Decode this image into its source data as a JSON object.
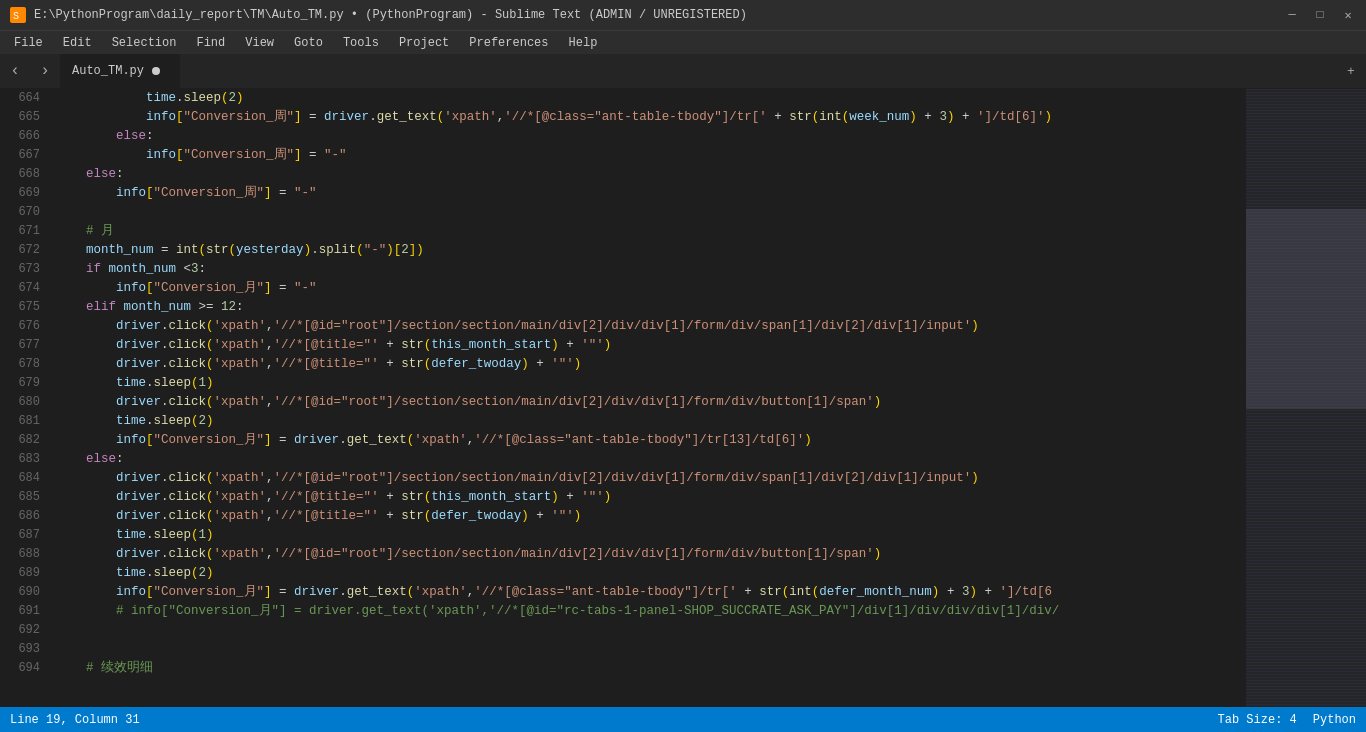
{
  "titlebar": {
    "title": "E:\\PythonProgram\\daily_report\\TM\\Auto_TM.py • (PythonProgram) - Sublime Text (ADMIN / UNREGISTERED)",
    "minimize": "─",
    "maximize": "□",
    "close": "✕"
  },
  "menubar": {
    "items": [
      "File",
      "Edit",
      "Selection",
      "Find",
      "View",
      "Goto",
      "Tools",
      "Project",
      "Preferences",
      "Help"
    ]
  },
  "tabs": [
    {
      "label": "Auto_TM.py",
      "active": true,
      "modified": true
    }
  ],
  "statusbar": {
    "left": {
      "position": "Line 19, Column 31"
    },
    "right": {
      "tab_size": "Tab Size: 4",
      "language": "Python"
    }
  },
  "lines": [
    {
      "num": 664,
      "indent": 2,
      "content": "time.sleep(2)"
    },
    {
      "num": 665,
      "indent": 2,
      "content": "info[\"Conversion_周\"] = driver.get_text('xpath','///*[@class=\"ant-table-tbody\"]/tr[' + str(int(week_num) + 3) + ']/td[6]')"
    },
    {
      "num": 666,
      "indent": 1,
      "content": "else:"
    },
    {
      "num": 667,
      "indent": 2,
      "content": "info[\"Conversion_周\"] = \"-\""
    },
    {
      "num": 668,
      "indent": 0,
      "content": "else:"
    },
    {
      "num": 669,
      "indent": 1,
      "content": "info[\"Conversion_周\"] = \"-\""
    },
    {
      "num": 670,
      "indent": 0,
      "content": ""
    },
    {
      "num": 671,
      "indent": 0,
      "content": "# 月"
    },
    {
      "num": 672,
      "indent": 0,
      "content": "month_num = int(str(yesterday).split(\"-\")[2])"
    },
    {
      "num": 673,
      "indent": 0,
      "content": "if month_num <3:"
    },
    {
      "num": 674,
      "indent": 1,
      "content": "info[\"Conversion_月\"] = \"-\""
    },
    {
      "num": 675,
      "indent": 0,
      "content": "elif month_num >= 12:"
    },
    {
      "num": 676,
      "indent": 1,
      "content": "driver.click('xpath','//*[@id=\"root\"]/section/section/main/div[2]/div/div[1]/form/div/span[1]/div[2]/div[1]/input')"
    },
    {
      "num": 677,
      "indent": 1,
      "content": "driver.click('xpath','//*[@title=\"' + str(this_month_start) + '\"')"
    },
    {
      "num": 678,
      "indent": 1,
      "content": "driver.click('xpath','//*[@title=\"' + str(defer_twoday) + '\"')"
    },
    {
      "num": 679,
      "indent": 1,
      "content": "time.sleep(1)"
    },
    {
      "num": 680,
      "indent": 1,
      "content": "driver.click('xpath','//*[@id=\"root\"]/section/section/main/div[2]/div/div[1]/form/div/button[1]/span')"
    },
    {
      "num": 681,
      "indent": 1,
      "content": "time.sleep(2)"
    },
    {
      "num": 682,
      "indent": 1,
      "content": "info[\"Conversion_月\"] = driver.get_text('xpath','//*[@class=\"ant-table-tbody\"]/tr[13]/td[6]')"
    },
    {
      "num": 683,
      "indent": 0,
      "content": "else:"
    },
    {
      "num": 684,
      "indent": 1,
      "content": "driver.click('xpath','//*[@id=\"root\"]/section/section/main/div[2]/div/div[1]/form/div/span[1]/div[2]/div[1]/input')"
    },
    {
      "num": 685,
      "indent": 1,
      "content": "driver.click('xpath','//*[@title=\"' + str(this_month_start) + '\"')"
    },
    {
      "num": 686,
      "indent": 1,
      "content": "driver.click('xpath','//*[@title=\"' + str(defer_twoday) + '\"')"
    },
    {
      "num": 687,
      "indent": 1,
      "content": "time.sleep(1)"
    },
    {
      "num": 688,
      "indent": 1,
      "content": "driver.click('xpath','//*[@id=\"root\"]/section/section/main/div[2]/div/div[1]/form/div/button[1]/span')"
    },
    {
      "num": 689,
      "indent": 1,
      "content": "time.sleep(2)"
    },
    {
      "num": 690,
      "indent": 1,
      "content": "info[\"Conversion_月\"] = driver.get_text('xpath','//*[@class=\"ant-table-tbody\"]/tr[' + str(int(defer_month_num) + 3) + ']/td[6"
    },
    {
      "num": 691,
      "indent": 1,
      "content": "# info[\"Conversion_月\"] = driver.get_text('xpath','//*[@id=\"rc-tabs-1-panel-SHOP_SUCCRATE_ASK_PAY\"]/div[1]/div/div/div[1]/div/"
    },
    {
      "num": 692,
      "indent": 0,
      "content": ""
    },
    {
      "num": 693,
      "indent": 0,
      "content": ""
    },
    {
      "num": 694,
      "indent": 0,
      "content": "# 续效明细"
    }
  ]
}
